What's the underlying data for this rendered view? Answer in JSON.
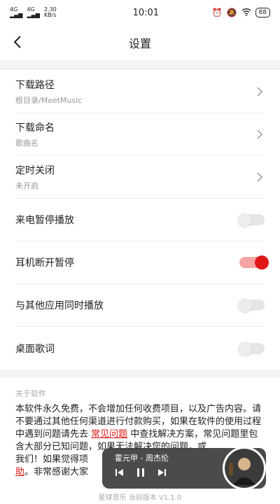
{
  "status_bar": {
    "signal1": "4G",
    "signal2": "4G",
    "speed": "2.30",
    "speed_unit": "KB/s",
    "time": "10:01",
    "battery": "88"
  },
  "header": {
    "title": "设置"
  },
  "settings": [
    {
      "label": "下载路径",
      "sub": "根目录/MeetMusic",
      "type": "link"
    },
    {
      "label": "下载命名",
      "sub": "歌曲名",
      "type": "link"
    },
    {
      "label": "定时关闭",
      "sub": "未开启",
      "type": "link"
    },
    {
      "label": "来电暂停播放",
      "type": "toggle",
      "on": false
    },
    {
      "label": "耳机断开暂停",
      "type": "toggle",
      "on": true
    },
    {
      "label": "与其他应用同时播放",
      "type": "toggle",
      "on": false
    },
    {
      "label": "桌面歌词",
      "type": "toggle",
      "on": false
    }
  ],
  "about": {
    "title": "关于软件",
    "text_before": "本软件永久免费，不会增加任何收费项目，以及广告内容。请不要通过其他任何渠道进行付款购买，如果在软件的使用过程中遇到问题请先去 ",
    "link": "常见问题",
    "text_after": " 中查找解决方案，常见问题里包含大部分已知问题，如果无法解决您的问题，或",
    "line_end1": "我们！如果觉得项",
    "link2": "助",
    "line_end2": "。非常感谢大家"
  },
  "player": {
    "song": "霍元甲 - 周杰伦"
  },
  "version": "星球音乐 当前版本 V1.1.0",
  "colors": {
    "accent": "#e01818"
  }
}
